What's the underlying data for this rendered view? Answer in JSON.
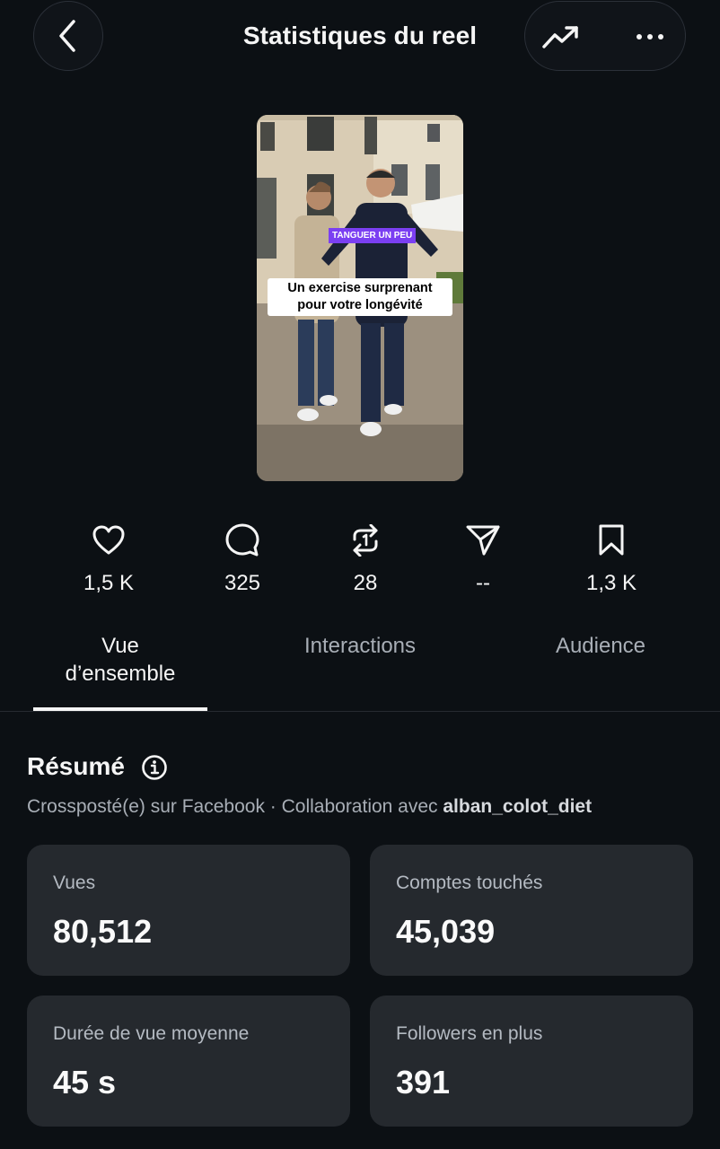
{
  "header": {
    "title": "Statistiques du reel",
    "back_icon": "chevron-left-icon",
    "trend_icon": "trending-up-icon",
    "more_icon": "more-horizontal-icon"
  },
  "thumbnail": {
    "tag": "TANGUER UN PEU",
    "caption_line1": "Un exercise surprenant",
    "caption_line2": "pour votre longévité"
  },
  "stats": [
    {
      "icon": "heart-icon",
      "value": "1,5 K"
    },
    {
      "icon": "comment-icon",
      "value": "325"
    },
    {
      "icon": "repost-icon",
      "value": "28"
    },
    {
      "icon": "share-icon",
      "value": "--"
    },
    {
      "icon": "bookmark-icon",
      "value": "1,3 K"
    }
  ],
  "tabs": [
    {
      "line1": "Vue",
      "line2": "d’ensemble",
      "active": true
    },
    {
      "line1": "Interactions",
      "active": false
    },
    {
      "line1": "Audience",
      "active": false
    }
  ],
  "summary": {
    "title": "Résumé",
    "subtitle_prefix": "Crossposté(e) sur Facebook · Collaboration avec ",
    "collaborator": "alban_colot_diet",
    "cards": [
      {
        "label": "Vues",
        "value": "80,512"
      },
      {
        "label": "Comptes touchés",
        "value": "45,039"
      },
      {
        "label": "Durée de vue moyenne",
        "value": "45 s"
      },
      {
        "label": "Followers en plus",
        "value": "391"
      }
    ]
  },
  "colors": {
    "background": "#0c1014",
    "card": "#25292e",
    "tag_purple": "#7b3ff2"
  }
}
